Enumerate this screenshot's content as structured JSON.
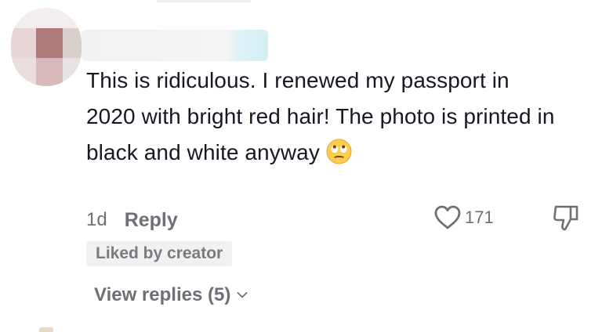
{
  "comment": {
    "text": "This is ridiculous. I renewed my passport in 2020 with bright red hair! The photo is printed in black and white anyway",
    "emoji": "face-with-rolling-eyes",
    "age": "1d",
    "reply_label": "Reply",
    "like_count": "171",
    "liked_by_creator_label": "Liked by creator",
    "view_replies_label": "View replies (5)"
  },
  "icons": {
    "like": "heart-outline-icon",
    "dislike": "thumbs-down-icon",
    "expand": "chevron-down-icon"
  },
  "colors": {
    "text": "#161823",
    "secondary": "#6f7075",
    "badge_bg": "#f1f1f2"
  }
}
